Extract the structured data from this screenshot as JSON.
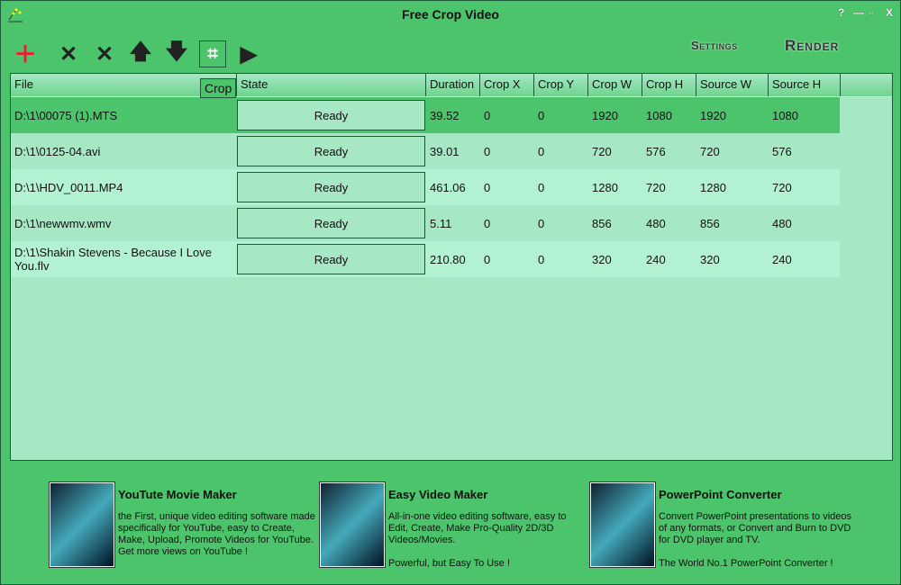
{
  "window": {
    "title": "Free Crop Video",
    "controls": [
      "?",
      "—",
      "▫",
      "X"
    ]
  },
  "toolbar": {
    "tooltip": "Crop",
    "settings": "Settings",
    "render": "Render"
  },
  "columns": [
    "File",
    "State",
    "Duration",
    "Crop X",
    "Crop Y",
    "Crop W",
    "Crop H",
    "Source W",
    "Source H"
  ],
  "rows": [
    [
      "D:\\1\\00075 (1).MTS",
      "Ready",
      "39.52",
      "0",
      "0",
      "1920",
      "1080",
      "1920",
      "1080"
    ],
    [
      "D:\\1\\0125-04.avi",
      "Ready",
      "39.01",
      "0",
      "0",
      "720",
      "576",
      "720",
      "576"
    ],
    [
      "D:\\1\\HDV_0011.MP4",
      "Ready",
      "461.06",
      "0",
      "0",
      "1280",
      "720",
      "1280",
      "720"
    ],
    [
      "D:\\1\\newwmv.wmv",
      "Ready",
      "5.11",
      "0",
      "0",
      "856",
      "480",
      "856",
      "480"
    ],
    [
      "D:\\1\\Shakin Stevens - Because I Love You.flv",
      "Ready",
      "210.80",
      "0",
      "0",
      "320",
      "240",
      "320",
      "240"
    ]
  ],
  "ads": [
    {
      "title": "YouTute Movie Maker",
      "desc": [
        "the First, unique video editing software made specifically for YouTube, easy to Create, Make, Upload, Promote Videos for YouTube.",
        "Get more views on YouTube !"
      ]
    },
    {
      "title": "Easy Video Maker",
      "desc": [
        "All-in-one video editing software, easy to Edit, Create, Make Pro-Quality 2D/3D Videos/Movies.",
        "",
        "Powerful, but Easy To Use !"
      ]
    },
    {
      "title": "PowerPoint Converter",
      "desc": [
        "Convert PowerPoint presentations to videos of any formats, or Convert and Burn to DVD for DVD player and TV.",
        "",
        "The World No.1 PowerPoint Converter !"
      ]
    }
  ],
  "colors": {
    "bg": "#4cc46c",
    "selected_row": "#4cc46c",
    "row_a": "#a6e8c4",
    "row_b": "#b2f2d2",
    "border": "#1d5a3a"
  }
}
